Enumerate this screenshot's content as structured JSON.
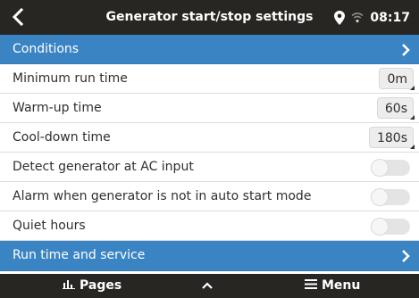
{
  "header": {
    "title": "Generator start/stop settings",
    "time": "08:17",
    "icons": {
      "back": "back-arrow-icon",
      "location": "location-pin-icon",
      "wifi": "wifi-icon"
    }
  },
  "rows": [
    {
      "label": "Conditions",
      "type": "submenu",
      "selected": true
    },
    {
      "label": "Minimum run time",
      "type": "value",
      "value": "0m"
    },
    {
      "label": "Warm-up time",
      "type": "value",
      "value": "60s"
    },
    {
      "label": "Cool-down time",
      "type": "value",
      "value": "180s"
    },
    {
      "label": "Detect generator at AC input",
      "type": "switch",
      "on": false
    },
    {
      "label": "Alarm when generator is not in auto start mode",
      "type": "switch",
      "on": false
    },
    {
      "label": "Quiet hours",
      "type": "switch",
      "on": false
    },
    {
      "label": "Run time and service",
      "type": "submenu",
      "selected": true
    }
  ],
  "footer": {
    "pages_label": "Pages",
    "menu_label": "Menu",
    "icons": {
      "pages": "pages-icon",
      "up": "chevron-up-icon",
      "menu": "menu-icon"
    }
  },
  "colors": {
    "header_bg": "#272622",
    "selected_row_bg": "#3b84c4",
    "switch_off": "#e4e4e4"
  }
}
